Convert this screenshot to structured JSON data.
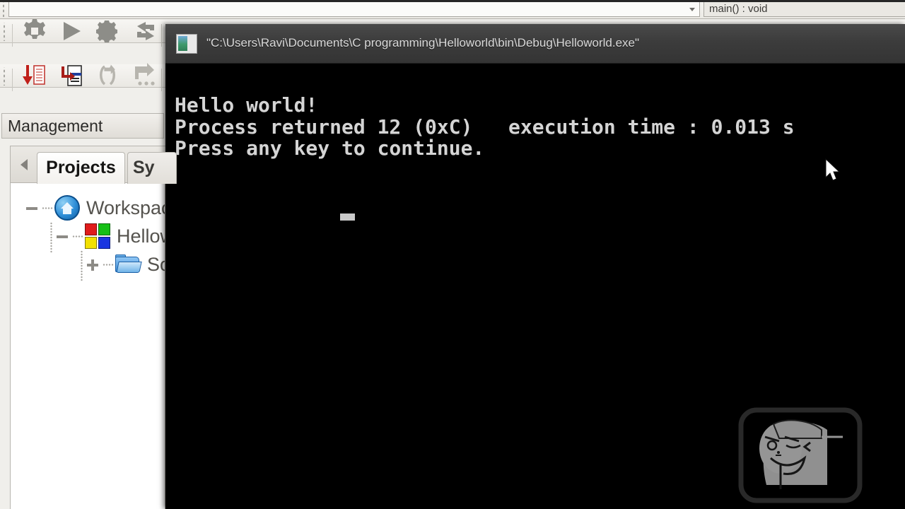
{
  "ide": {
    "scope_combo": {
      "value": "",
      "placeholder": ""
    },
    "function_combo": {
      "value": "main() : void"
    },
    "toolbar_compiler": {
      "buttons": [
        {
          "name": "build-button",
          "label": "Build",
          "icon": "gear-icon"
        },
        {
          "name": "run-button",
          "label": "Run",
          "icon": "play-icon"
        },
        {
          "name": "build-and-run-button",
          "label": "Build and run",
          "icon": "gear-play-icon"
        },
        {
          "name": "rebuild-button",
          "label": "Rebuild",
          "icon": "rebuild-arrows-icon"
        }
      ]
    },
    "toolbar_debug": {
      "buttons": [
        {
          "name": "step-into-button",
          "label": "Step into",
          "icon": "step-into-icon"
        },
        {
          "name": "next-line-button",
          "label": "Next line",
          "icon": "next-line-icon"
        },
        {
          "name": "step-out-button",
          "label": "Step out",
          "icon": "step-out-icon"
        },
        {
          "name": "run-to-cursor-button",
          "label": "Run to cursor",
          "icon": "run-to-cursor-icon"
        }
      ]
    },
    "management": {
      "title": "Management",
      "tabs": [
        {
          "label": "Projects",
          "active": true
        },
        {
          "label": "Sy",
          "active": false
        }
      ],
      "tree": [
        {
          "label": "Workspace",
          "icon": "home-icon",
          "expander": "minus",
          "depth": 0
        },
        {
          "label": "Hellow",
          "icon": "project-icon",
          "expander": "minus",
          "depth": 1
        },
        {
          "label": "So",
          "icon": "folder-icon",
          "expander": "plus",
          "depth": 2
        }
      ]
    }
  },
  "console": {
    "title": "\"C:\\Users\\Ravi\\Documents\\C programming\\Helloworld\\bin\\Debug\\Helloworld.exe\"",
    "icon": "console-window-icon",
    "output": "Hello world!\nProcess returned 12 (0xC)   execution time : 0.013 s\nPress any key to continue.",
    "lines": [
      "Hello world!",
      "Process returned 12 (0xC)   execution time : 0.013 s",
      "Press any key to continue."
    ],
    "program_output": "Hello world!",
    "return_code": "12",
    "return_code_hex": "0xC",
    "execution_time": "0.013 s",
    "prompt": "Press any key to continue.",
    "background_color": "#000000",
    "text_color": "#d4d4d4",
    "titlebar_color": "#3c3c3c"
  },
  "overlay": {
    "watermark_name": "cartoon-face-watermark",
    "cursor_name": "mouse-pointer"
  }
}
